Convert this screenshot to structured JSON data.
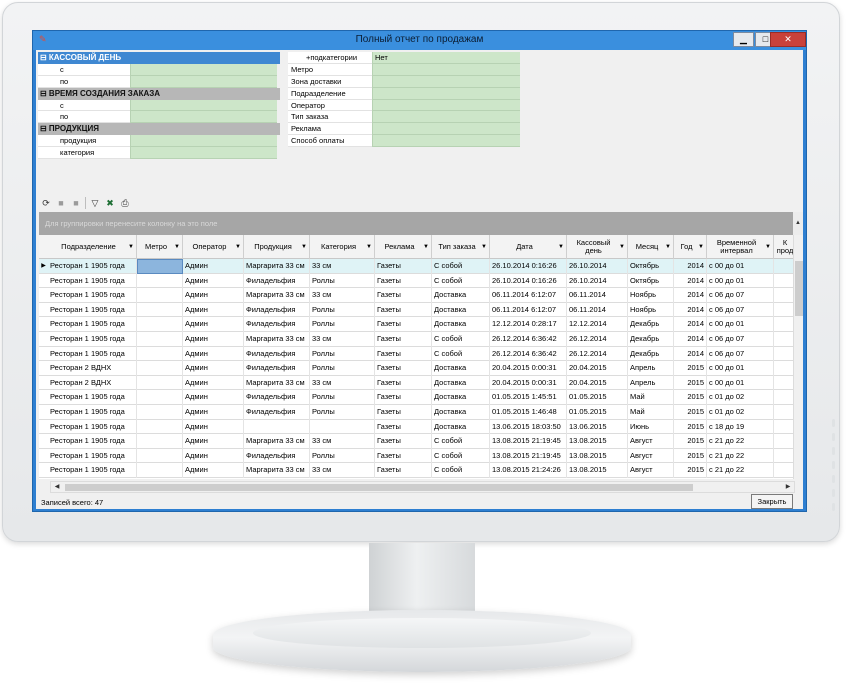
{
  "window": {
    "title": "Полный отчет по продажам",
    "minimize": "▁",
    "maximize": "□",
    "close": "✕"
  },
  "filters_left": {
    "groups": [
      {
        "title": "⊟ КАССОВЫЙ ДЕНЬ",
        "rows": [
          "с",
          "по"
        ]
      },
      {
        "title": "⊟ ВРЕМЯ СОЗДАНИЯ ЗАКАЗА",
        "rows": [
          "с",
          "по"
        ]
      },
      {
        "title": "⊟ ПРОДУКЦИЯ",
        "rows": [
          "продукция",
          "категория"
        ]
      }
    ]
  },
  "filters_right": {
    "rows": [
      {
        "label": "+подкатегории",
        "value": "Нет"
      },
      {
        "label": "Метро",
        "value": ""
      },
      {
        "label": "Зона доставки",
        "value": ""
      },
      {
        "label": "Подразделение",
        "value": ""
      },
      {
        "label": "Оператор",
        "value": ""
      },
      {
        "label": "Тип заказа",
        "value": ""
      },
      {
        "label": "Реклама",
        "value": ""
      },
      {
        "label": "Способ оплаты",
        "value": ""
      }
    ]
  },
  "toolbar": {
    "icons": [
      "refresh-icon",
      "stop-icon",
      "stop-icon",
      "filter-icon",
      "export-excel-icon",
      "print-icon"
    ]
  },
  "group_panel_text": "Для группировки перенесите колонку на это поле",
  "grid": {
    "columns": [
      "Подразделение",
      "Метро",
      "Оператор",
      "Продукция",
      "Категория",
      "Реклама",
      "Тип заказа",
      "Дата",
      "Кассовый день",
      "Месяц",
      "Год",
      "Временной интервал",
      "К прод"
    ],
    "rows": [
      [
        "Ресторан 1 1905 года",
        "",
        "Админ",
        "Маргарита 33 см",
        "33 см",
        "Газеты",
        "С собой",
        "26.10.2014 0:16:26",
        "26.10.2014",
        "Октябрь",
        "2014",
        "с 00 до 01"
      ],
      [
        "Ресторан 1 1905 года",
        "",
        "Админ",
        "Филадельфия",
        "Роллы",
        "Газеты",
        "С собой",
        "26.10.2014 0:16:26",
        "26.10.2014",
        "Октябрь",
        "2014",
        "с 00 до 01"
      ],
      [
        "Ресторан 1 1905 года",
        "",
        "Админ",
        "Маргарита 33 см",
        "33 см",
        "Газеты",
        "Доставка",
        "06.11.2014 6:12:07",
        "06.11.2014",
        "Ноябрь",
        "2014",
        "с 06 до 07"
      ],
      [
        "Ресторан 1 1905 года",
        "",
        "Админ",
        "Филадельфия",
        "Роллы",
        "Газеты",
        "Доставка",
        "06.11.2014 6:12:07",
        "06.11.2014",
        "Ноябрь",
        "2014",
        "с 06 до 07"
      ],
      [
        "Ресторан 1 1905 года",
        "",
        "Админ",
        "Филадельфия",
        "Роллы",
        "Газеты",
        "Доставка",
        "12.12.2014 0:28:17",
        "12.12.2014",
        "Декабрь",
        "2014",
        "с 00 до 01"
      ],
      [
        "Ресторан 1 1905 года",
        "",
        "Админ",
        "Маргарита 33 см",
        "33 см",
        "Газеты",
        "С собой",
        "26.12.2014 6:36:42",
        "26.12.2014",
        "Декабрь",
        "2014",
        "с 06 до 07"
      ],
      [
        "Ресторан 1 1905 года",
        "",
        "Админ",
        "Филадельфия",
        "Роллы",
        "Газеты",
        "С собой",
        "26.12.2014 6:36:42",
        "26.12.2014",
        "Декабрь",
        "2014",
        "с 06 до 07"
      ],
      [
        "Ресторан 2 ВДНХ",
        "",
        "Админ",
        "Филадельфия",
        "Роллы",
        "Газеты",
        "Доставка",
        "20.04.2015 0:00:31",
        "20.04.2015",
        "Апрель",
        "2015",
        "с 00 до 01"
      ],
      [
        "Ресторан 2 ВДНХ",
        "",
        "Админ",
        "Маргарита 33 см",
        "33 см",
        "Газеты",
        "Доставка",
        "20.04.2015 0:00:31",
        "20.04.2015",
        "Апрель",
        "2015",
        "с 00 до 01"
      ],
      [
        "Ресторан 1 1905 года",
        "",
        "Админ",
        "Филадельфия",
        "Роллы",
        "Газеты",
        "Доставка",
        "01.05.2015 1:45:51",
        "01.05.2015",
        "Май",
        "2015",
        "с 01 до 02"
      ],
      [
        "Ресторан 1 1905 года",
        "",
        "Админ",
        "Филадельфия",
        "Роллы",
        "Газеты",
        "Доставка",
        "01.05.2015 1:46:48",
        "01.05.2015",
        "Май",
        "2015",
        "с 01 до 02"
      ],
      [
        "Ресторан 1 1905 года",
        "",
        "Админ",
        "",
        "",
        "Газеты",
        "Доставка",
        "13.06.2015 18:03:50",
        "13.06.2015",
        "Июнь",
        "2015",
        "с 18 до 19"
      ],
      [
        "Ресторан 1 1905 года",
        "",
        "Админ",
        "Маргарита 33 см",
        "33 см",
        "Газеты",
        "С собой",
        "13.08.2015 21:19:45",
        "13.08.2015",
        "Август",
        "2015",
        "с 21 до 22"
      ],
      [
        "Ресторан 1 1905 года",
        "",
        "Админ",
        "Филадельфия",
        "Роллы",
        "Газеты",
        "С собой",
        "13.08.2015 21:19:45",
        "13.08.2015",
        "Август",
        "2015",
        "с 21 до 22"
      ],
      [
        "Ресторан 1 1905 года",
        "",
        "Админ",
        "Маргарита 33 см",
        "33 см",
        "Газеты",
        "С собой",
        "13.08.2015 21:24:26",
        "13.08.2015",
        "Август",
        "2015",
        "с 21 до 22"
      ]
    ]
  },
  "status": "Записей всего: 47",
  "close_button": "Закрыть",
  "colors": {
    "titlebar": "#3a8fde",
    "filter_header_active": "#3f88d2",
    "filter_header": "#b7b7b7",
    "filter_value": "#cde6c9",
    "selected_row": "#dff3f6",
    "selected_cell": "#8cb5dd"
  }
}
